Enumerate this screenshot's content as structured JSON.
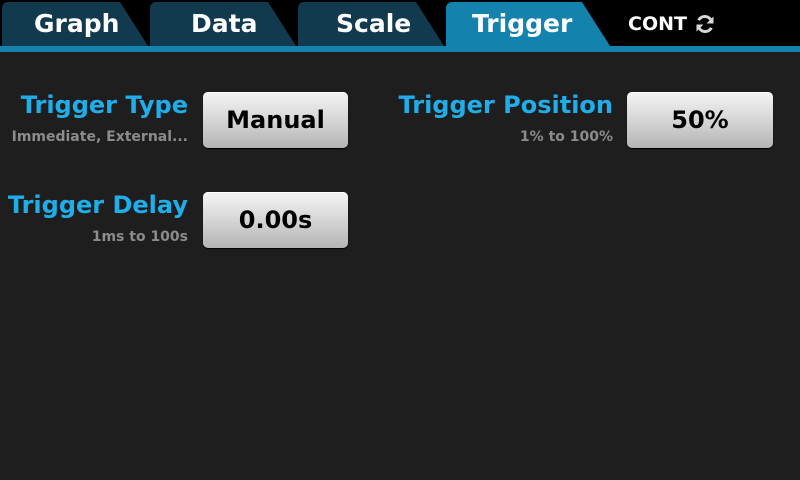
{
  "tabs": [
    {
      "label": "Graph",
      "active": false
    },
    {
      "label": "Data",
      "active": false
    },
    {
      "label": "Scale",
      "active": false
    },
    {
      "label": "Trigger",
      "active": true
    }
  ],
  "status": {
    "mode_label": "CONT",
    "icon": "refresh-icon"
  },
  "trigger_type": {
    "title": "Trigger Type",
    "subtitle": "Immediate, External...",
    "value": "Manual"
  },
  "trigger_delay": {
    "title": "Trigger Delay",
    "subtitle": "1ms to 100s",
    "value": "0.00s"
  },
  "trigger_position": {
    "title": "Trigger Position",
    "subtitle": "1% to 100%",
    "value": "50%"
  },
  "colors": {
    "background": "#1e1e1e",
    "tab_inactive": "#123a4e",
    "tab_active": "#1383ad",
    "accent_label": "#1faeea",
    "subtitle": "#8c8c8c"
  }
}
